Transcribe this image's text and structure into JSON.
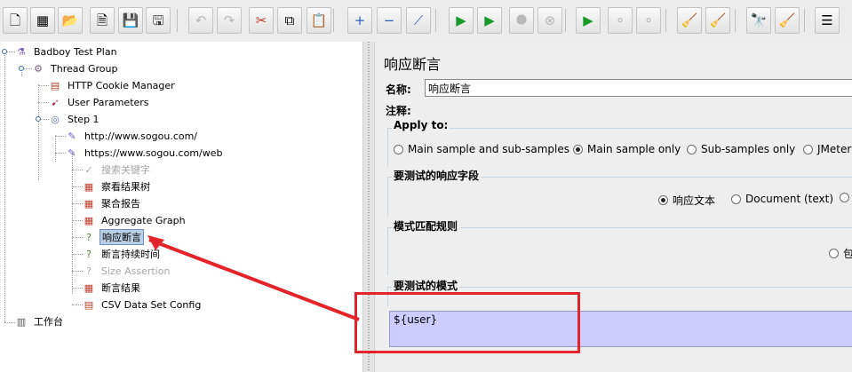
{
  "toolbar": {
    "buttons": [
      {
        "icon": "new-icon",
        "glyph": "🗋",
        "disabled": false
      },
      {
        "icon": "templates-icon",
        "glyph": "▦",
        "disabled": false
      },
      {
        "icon": "open-icon",
        "glyph": "📂",
        "disabled": false
      },
      {
        "icon": "close-icon",
        "glyph": "🗎",
        "disabled": false
      },
      {
        "icon": "save-icon",
        "glyph": "💾",
        "disabled": false
      },
      {
        "icon": "save-as-icon",
        "glyph": "🖫",
        "disabled": false
      },
      {
        "icon": "undo-icon",
        "glyph": "↶",
        "disabled": true
      },
      {
        "icon": "redo-icon",
        "glyph": "↷",
        "disabled": true
      },
      {
        "icon": "cut-icon",
        "glyph": "✂",
        "disabled": false
      },
      {
        "icon": "copy-icon",
        "glyph": "⧉",
        "disabled": false
      },
      {
        "icon": "paste-icon",
        "glyph": "📋",
        "disabled": false
      },
      {
        "icon": "expand-icon",
        "glyph": "+",
        "disabled": false
      },
      {
        "icon": "collapse-icon",
        "glyph": "−",
        "disabled": false
      },
      {
        "icon": "toggle-icon",
        "glyph": "⟋",
        "disabled": false
      },
      {
        "icon": "start-icon",
        "glyph": "▶",
        "disabled": false
      },
      {
        "icon": "start-no-pauses-icon",
        "glyph": "▶",
        "disabled": false
      },
      {
        "icon": "stop-icon",
        "glyph": "⯃",
        "disabled": true
      },
      {
        "icon": "shutdown-icon",
        "glyph": "⊗",
        "disabled": true
      },
      {
        "icon": "remote-start-icon",
        "glyph": "▶",
        "disabled": false
      },
      {
        "icon": "remote-stop-icon",
        "glyph": "⚬",
        "disabled": true
      },
      {
        "icon": "remote-shutdown-icon",
        "glyph": "⚬",
        "disabled": true
      },
      {
        "icon": "clear-icon",
        "glyph": "🧹",
        "disabled": false
      },
      {
        "icon": "clear-all-icon",
        "glyph": "🧹",
        "disabled": false
      },
      {
        "icon": "search-icon",
        "glyph": "🔭",
        "disabled": false
      },
      {
        "icon": "reset-search-icon",
        "glyph": "🧹",
        "disabled": false
      },
      {
        "icon": "function-helper-icon",
        "glyph": "☰",
        "disabled": false
      }
    ]
  },
  "tree": {
    "nodes": [
      {
        "label": "Badboy Test Plan",
        "icon": "test-plan-icon",
        "glyph": "⚗",
        "color": "#7a5bb5",
        "disabled": false,
        "selected": false
      },
      {
        "label": "Thread Group",
        "icon": "thread-group-icon",
        "glyph": "⚙",
        "color": "#7b5d8a",
        "disabled": false,
        "selected": false
      },
      {
        "label": "HTTP Cookie Manager",
        "icon": "cookie-manager-icon",
        "glyph": "▤",
        "color": "#a8432a",
        "disabled": false,
        "selected": false
      },
      {
        "label": "User Parameters",
        "icon": "user-parameters-icon",
        "glyph": "➹",
        "color": "#a23a5a",
        "disabled": false,
        "selected": false
      },
      {
        "label": "Step 1",
        "icon": "step-controller-icon",
        "glyph": "◎",
        "color": "#5d6fa2",
        "disabled": false,
        "selected": false
      },
      {
        "label": "http://www.sogou.com/",
        "icon": "http-sampler-icon",
        "glyph": "✎",
        "color": "#6a5acd",
        "disabled": false,
        "selected": false
      },
      {
        "label": "https://www.sogou.com/web",
        "icon": "http-sampler-icon",
        "glyph": "✎",
        "color": "#6a5acd",
        "disabled": false,
        "selected": false
      },
      {
        "label": "搜索关键字",
        "icon": "assertion-icon",
        "glyph": "✓",
        "color": "#a5a5a5",
        "disabled": true,
        "selected": false
      },
      {
        "label": "察看结果树",
        "icon": "listener-icon",
        "glyph": "▦",
        "color": "#c0392b",
        "disabled": false,
        "selected": false
      },
      {
        "label": "聚合报告",
        "icon": "listener-icon",
        "glyph": "▦",
        "color": "#c0392b",
        "disabled": false,
        "selected": false
      },
      {
        "label": "Aggregate Graph",
        "icon": "listener-icon",
        "glyph": "▦",
        "color": "#c0392b",
        "disabled": false,
        "selected": false
      },
      {
        "label": "响应断言",
        "icon": "response-assertion-icon",
        "glyph": "?",
        "color": "#4b7f2e",
        "disabled": false,
        "selected": true
      },
      {
        "label": "断言持续时间",
        "icon": "duration-assertion-icon",
        "glyph": "?",
        "color": "#4b7f2e",
        "disabled": false,
        "selected": false
      },
      {
        "label": "Size Assertion",
        "icon": "size-assertion-icon",
        "glyph": "?",
        "color": "#a5a5a5",
        "disabled": true,
        "selected": false
      },
      {
        "label": "断言结果",
        "icon": "listener-icon",
        "glyph": "▦",
        "color": "#c0392b",
        "disabled": false,
        "selected": false
      },
      {
        "label": "CSV Data Set Config",
        "icon": "csv-config-icon",
        "glyph": "▤",
        "color": "#a8432a",
        "disabled": false,
        "selected": false
      },
      {
        "label": "工作台",
        "icon": "workbench-icon",
        "glyph": "▥",
        "color": "#555555",
        "disabled": false,
        "selected": false
      }
    ]
  },
  "panel": {
    "title": "响应断言",
    "name_label": "名称:",
    "name_value": "响应断言",
    "comment_label": "注释:",
    "apply_to": {
      "title": "Apply to:",
      "options": [
        {
          "label": "Main sample and sub-samples",
          "selected": false
        },
        {
          "label": "Main sample only",
          "selected": true
        },
        {
          "label": "Sub-samples only",
          "selected": false
        },
        {
          "label": "JMeter",
          "selected": false
        }
      ]
    },
    "response_field": {
      "title": "要测试的响应字段",
      "options": [
        {
          "label": "响应文本",
          "selected": true
        },
        {
          "label": "Document (text)",
          "selected": false
        },
        {
          "label": "",
          "selected": false
        }
      ]
    },
    "pattern_rules": {
      "title": "模式匹配规则",
      "options": [
        {
          "label": "包",
          "selected": false
        }
      ]
    },
    "patterns": {
      "title": "要测试的模式",
      "value": "${user}"
    }
  }
}
